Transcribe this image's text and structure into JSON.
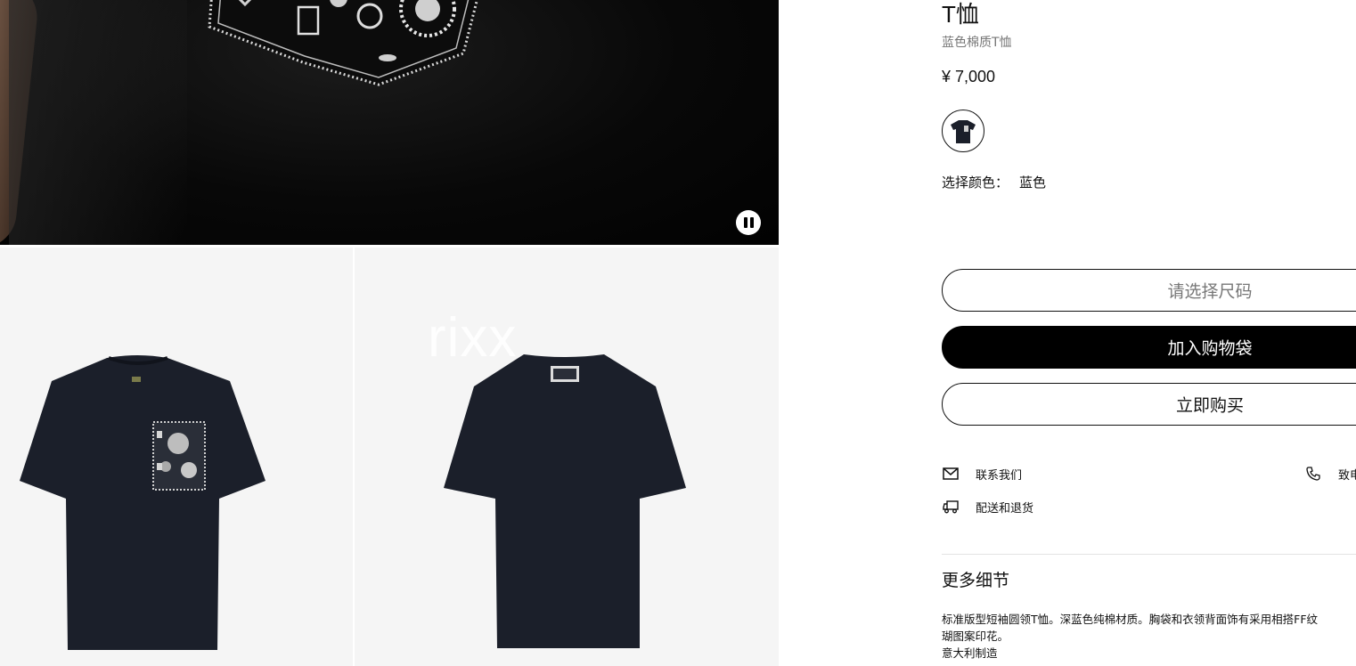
{
  "gallery": {
    "watermark": "rixx"
  },
  "product": {
    "title": "T恤",
    "subtitle": "蓝色棉质T恤",
    "price": "¥ 7,000",
    "color_label": "选择颜色：",
    "color_value": "蓝色",
    "size_button": "请选择尺码",
    "add_to_bag": "加入购物袋",
    "buy_now": "立即购买"
  },
  "service_links": {
    "contact": "联系我们",
    "shipping": "配送和退货",
    "phone": "致电"
  },
  "details": {
    "heading": "更多细节",
    "line1": "标准版型短袖圆领T恤。深蓝色纯棉材质。胸袋和衣领背面饰有采用相搭FF纹",
    "line2": "瑚图案印花。",
    "line3": "意大利制造"
  },
  "colors": {
    "shirt": "#1b1f2a",
    "button_black": "#000000"
  }
}
